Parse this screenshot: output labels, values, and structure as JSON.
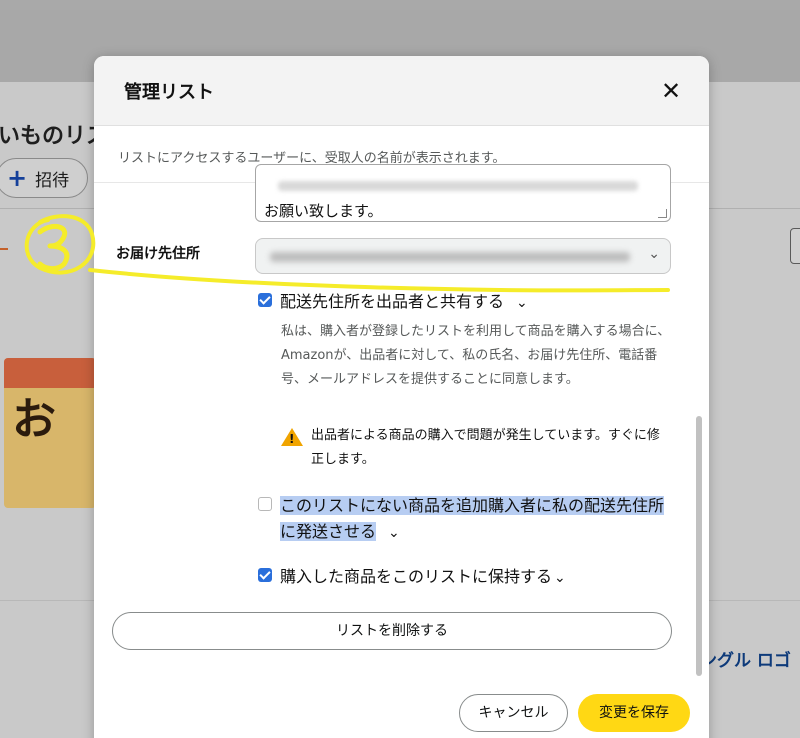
{
  "background": {
    "list_title": "いものリス",
    "invite_label": "招待",
    "footer_link": "ングル ロゴ"
  },
  "modal": {
    "title": "管理リスト",
    "close_icon": "close-icon",
    "note": "リストにアクセスするユーザーに、受取人の名前が表示されます。",
    "message_tail": "お願い致します。",
    "address_label": "お届け先住所",
    "share_address": {
      "label": "配送先住所を出品者と共有する",
      "checked": true,
      "description": "私は、購入者が登録したリストを利用して商品を購入する場合に、Amazonが、出品者に対して、私の氏名、お届け先住所、電話番号、メールアドレスを提供することに同意します。",
      "warning": "出品者による商品の購入で問題が発生しています。すぐに修正します。"
    },
    "ship_unlisted": {
      "label": "このリストにない商品を追加購入者に私の配送先住所に発送させる",
      "checked": false
    },
    "keep_purchased": {
      "label": "購入した商品をこのリストに保持する",
      "checked": true
    },
    "delete_label": "リストを削除する",
    "cancel_label": "キャンセル",
    "save_label": "変更を保存"
  },
  "annotation": {
    "number": "3",
    "color": "#f5ec2a"
  },
  "colors": {
    "checkbox": "#2a6fdb",
    "save_button": "#ffd814",
    "highlight": "#b7cdf2",
    "warning": "#f0a400"
  }
}
